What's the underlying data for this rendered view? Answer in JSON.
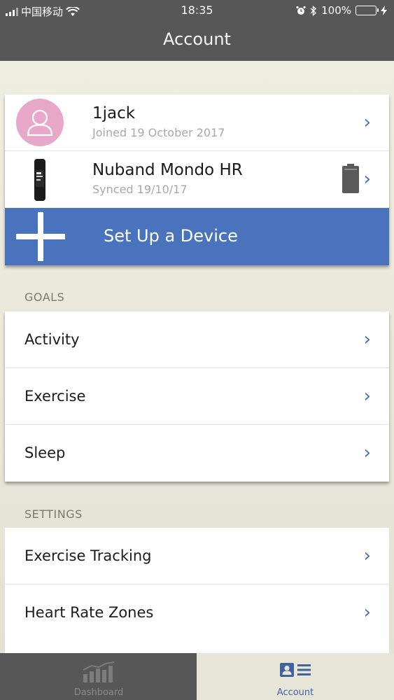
{
  "status_bar": {
    "carrier": "中国移动",
    "time": "18:35",
    "battery": "100%"
  },
  "header": {
    "title": "Account"
  },
  "profile": {
    "name": "1jack",
    "joined": "Joined 19 October 2017"
  },
  "device": {
    "name": "Nuband Mondo HR",
    "synced": "Synced 19/10/17"
  },
  "setup_device": {
    "label": "Set Up a Device"
  },
  "goals": {
    "label": "GOALS",
    "items": [
      {
        "label": "Activity"
      },
      {
        "label": "Exercise"
      },
      {
        "label": "Sleep"
      }
    ]
  },
  "settings": {
    "label": "SETTINGS",
    "items": [
      {
        "label": "Exercise Tracking"
      },
      {
        "label": "Heart Rate Zones"
      }
    ]
  },
  "tabs": [
    {
      "label": "Dashboard",
      "icon": "bar-chart-icon",
      "active": false
    },
    {
      "label": "Account",
      "icon": "contact-card-icon",
      "active": true
    }
  ],
  "colors": {
    "accent": "#4a73bd",
    "header": "#575757",
    "chevron": "#4a6fad",
    "avatar": "#e7a8c9"
  }
}
